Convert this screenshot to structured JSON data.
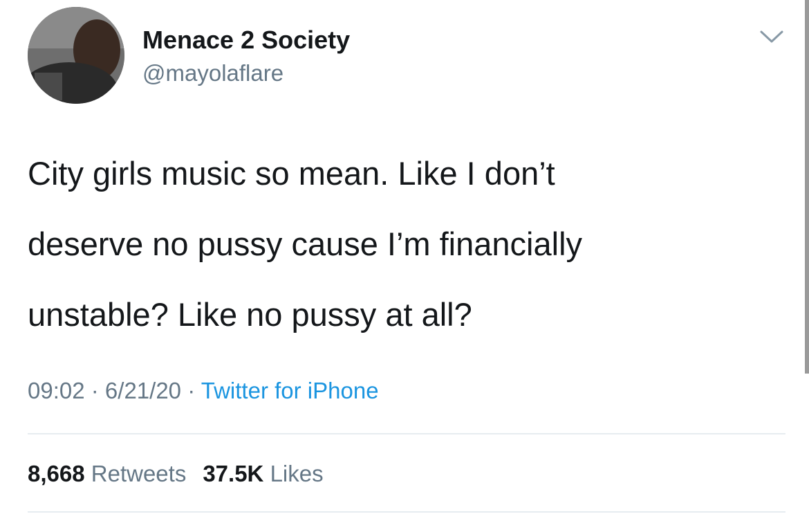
{
  "user": {
    "display_name": "Menace 2 Society",
    "handle": "@mayolaflare"
  },
  "tweet": {
    "lines": [
      "City girls music so mean. Like I don’t",
      "deserve no pussy cause I’m financially",
      "unstable? Like no pussy at all?"
    ]
  },
  "meta": {
    "time": "09:02",
    "date": "6/21/20",
    "separator": " · ",
    "source": "Twitter for iPhone"
  },
  "stats": {
    "retweets_count": "8,668",
    "retweets_label": "Retweets",
    "likes_count": "37.5K",
    "likes_label": "Likes"
  },
  "icons": {
    "more": "chevron-down-icon"
  },
  "colors": {
    "text": "#14171a",
    "secondary": "#657786",
    "link": "#1b95e0",
    "divider": "#e6ecf0"
  }
}
